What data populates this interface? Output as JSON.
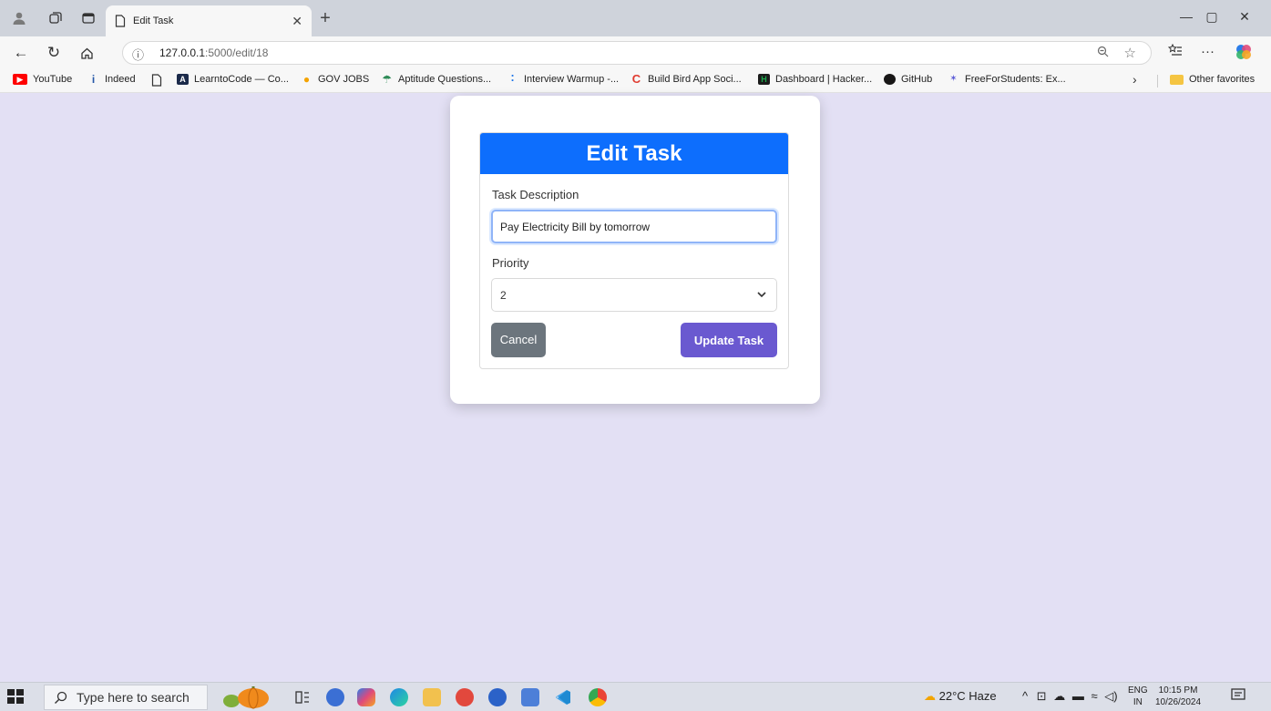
{
  "browser": {
    "tab_title": "Edit Task",
    "url_host": "127.0.0.1",
    "url_path": ":5000/edit/18",
    "bookmarks": [
      {
        "label": "YouTube",
        "icon": "youtube-icon",
        "color": "#ff0000"
      },
      {
        "label": "Indeed",
        "icon": "indeed-icon",
        "color": "#2557a7"
      },
      {
        "label": "",
        "icon": "page-icon",
        "color": "#555555"
      },
      {
        "label": "LearntoCode — Co...",
        "icon": "learntocode-icon",
        "color": "#1b2a4a"
      },
      {
        "label": "GOV JOBS",
        "icon": "govjobs-icon",
        "color": "#f4a300"
      },
      {
        "label": "Aptitude Questions...",
        "icon": "aptitude-icon",
        "color": "#2e8b57"
      },
      {
        "label": "Interview Warmup -...",
        "icon": "interview-icon",
        "color": "#1a73e8"
      },
      {
        "label": "Build Bird App Soci...",
        "icon": "build-bird-icon",
        "color": "#e03a2f"
      },
      {
        "label": "Dashboard | Hacker...",
        "icon": "hackerrank-icon",
        "color": "#1ba94c"
      },
      {
        "label": "GitHub",
        "icon": "github-icon",
        "color": "#181717"
      },
      {
        "label": "FreeForStudents: Ex...",
        "icon": "freeforstudents-icon",
        "color": "#5b5bd6"
      }
    ],
    "other_favorites": "Other favorites"
  },
  "form": {
    "title": "Edit Task",
    "description_label": "Task Description",
    "description_value": "Pay Electricity Bill by tomorrow",
    "priority_label": "Priority",
    "priority_value": "2",
    "cancel_label": "Cancel",
    "update_label": "Update Task",
    "colors": {
      "header": "#0d6efd",
      "update": "#6a59d0",
      "cancel": "#6c757d",
      "page_bg": "#e3e0f4"
    }
  },
  "taskbar": {
    "search_placeholder": "Type here to search",
    "weather": "22°C  Haze",
    "lang_top": "ENG",
    "lang_bottom": "IN",
    "time": "10:15 PM",
    "date": "10/26/2024"
  }
}
